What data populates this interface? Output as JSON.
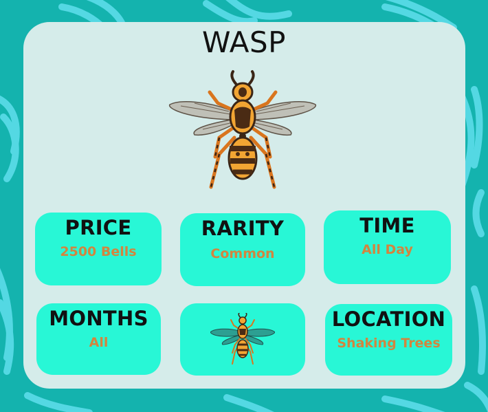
{
  "title": "WASP",
  "stats": {
    "price": {
      "label": "PRICE",
      "value": "2500 Bells"
    },
    "rarity": {
      "label": "RARITY",
      "value": "Common"
    },
    "time": {
      "label": "TIME",
      "value": "All Day"
    },
    "months": {
      "label": "MONTHS",
      "value": "All"
    },
    "location": {
      "label": "LOCATION",
      "value": "Shaking Trees"
    }
  },
  "colors": {
    "background": "#14b3ae",
    "pattern": "#54d8e3",
    "card": "#d5ecea",
    "tile": "#28f7d6",
    "value_text": "#d2853f",
    "label_text": "#111111"
  },
  "icons": {
    "main_image": "wasp-illustration",
    "tile_image": "wasp-icon"
  }
}
